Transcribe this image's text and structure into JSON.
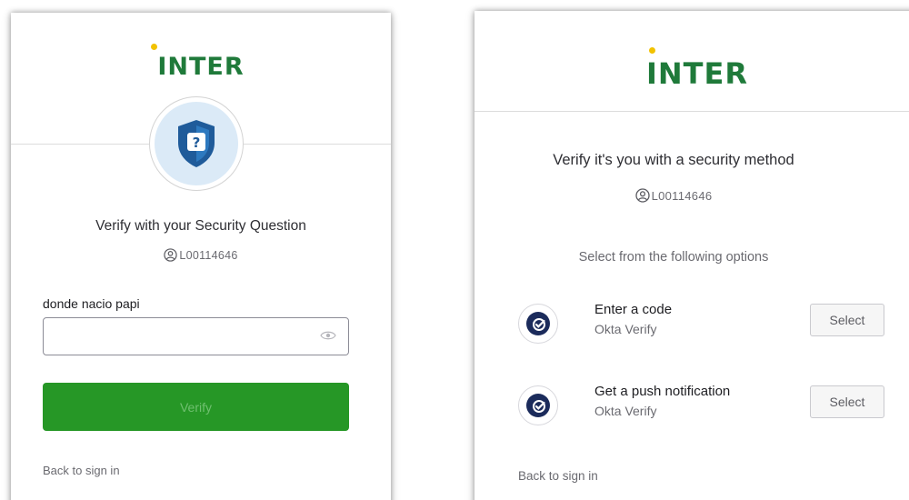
{
  "brand": {
    "logo_text": "INTER",
    "logo_color": "#1f7a3a",
    "dot_color": "#f2c200"
  },
  "security_question_card": {
    "badge_icon": "shield-question-icon",
    "title": "Verify with your Security Question",
    "username": "L00114646",
    "question_label": "donde nacio papi",
    "answer_value": "",
    "verify_label": "Verify",
    "verify_color": "#269726",
    "back_link": "Back to sign in"
  },
  "method_select_card": {
    "title": "Verify it's you with a security method",
    "username": "L00114646",
    "subtitle": "Select from the following options",
    "options": [
      {
        "title": "Enter a code",
        "provider": "Okta Verify",
        "icon": "okta-verify-icon",
        "button": "Select"
      },
      {
        "title": "Get a push notification",
        "provider": "Okta Verify",
        "icon": "okta-verify-icon",
        "button": "Select"
      }
    ],
    "back_link": "Back to sign in"
  }
}
